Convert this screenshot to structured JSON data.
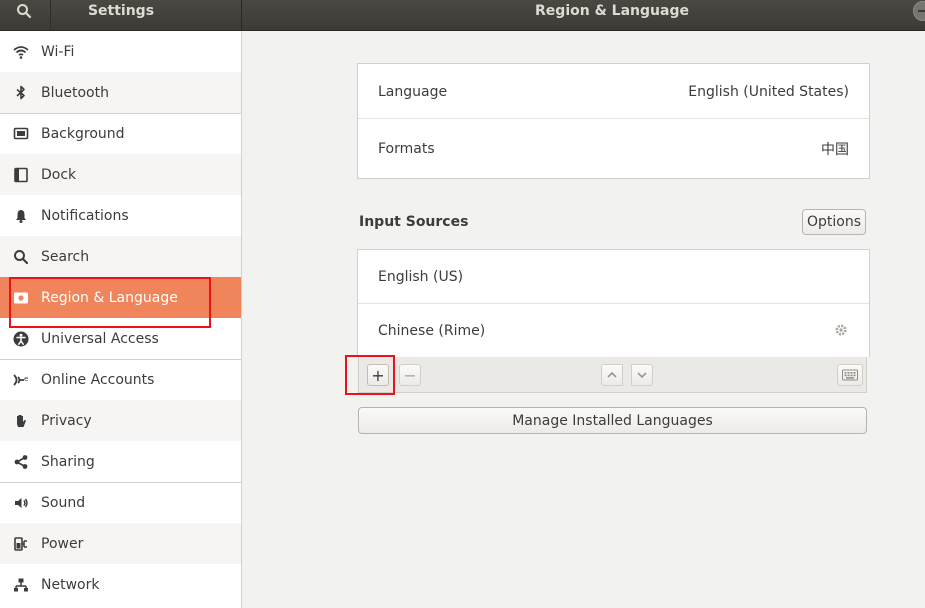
{
  "header": {
    "left_title": "Settings",
    "right_title": "Region & Language"
  },
  "sidebar": {
    "items": [
      {
        "label": "Wi-Fi",
        "icon": "wifi-icon"
      },
      {
        "label": "Bluetooth",
        "icon": "bluetooth-icon"
      },
      {
        "label": "Background",
        "icon": "background-icon"
      },
      {
        "label": "Dock",
        "icon": "dock-icon"
      },
      {
        "label": "Notifications",
        "icon": "bell-icon"
      },
      {
        "label": "Search",
        "icon": "search-icon"
      },
      {
        "label": "Region & Language",
        "icon": "flag-icon",
        "selected": true
      },
      {
        "label": "Universal Access",
        "icon": "accessibility-icon"
      },
      {
        "label": "Online Accounts",
        "icon": "online-accounts-icon"
      },
      {
        "label": "Privacy",
        "icon": "hand-icon"
      },
      {
        "label": "Sharing",
        "icon": "share-icon"
      },
      {
        "label": "Sound",
        "icon": "speaker-icon"
      },
      {
        "label": "Power",
        "icon": "plug-icon"
      },
      {
        "label": "Network",
        "icon": "network-icon"
      }
    ]
  },
  "main": {
    "language": {
      "label": "Language",
      "value": "English (United States)"
    },
    "formats": {
      "label": "Formats",
      "value": "中国"
    },
    "input_sources": {
      "title": "Input Sources",
      "options_label": "Options",
      "sources": [
        {
          "label": "English (US)"
        },
        {
          "label": "Chinese (Rime)"
        }
      ],
      "add_label": "+",
      "remove_label": "−"
    },
    "manage_label": "Manage Installed Languages"
  },
  "colors": {
    "accent": "#f0845a",
    "highlight": "#e8141c",
    "headerbar": "#3c3b37"
  }
}
